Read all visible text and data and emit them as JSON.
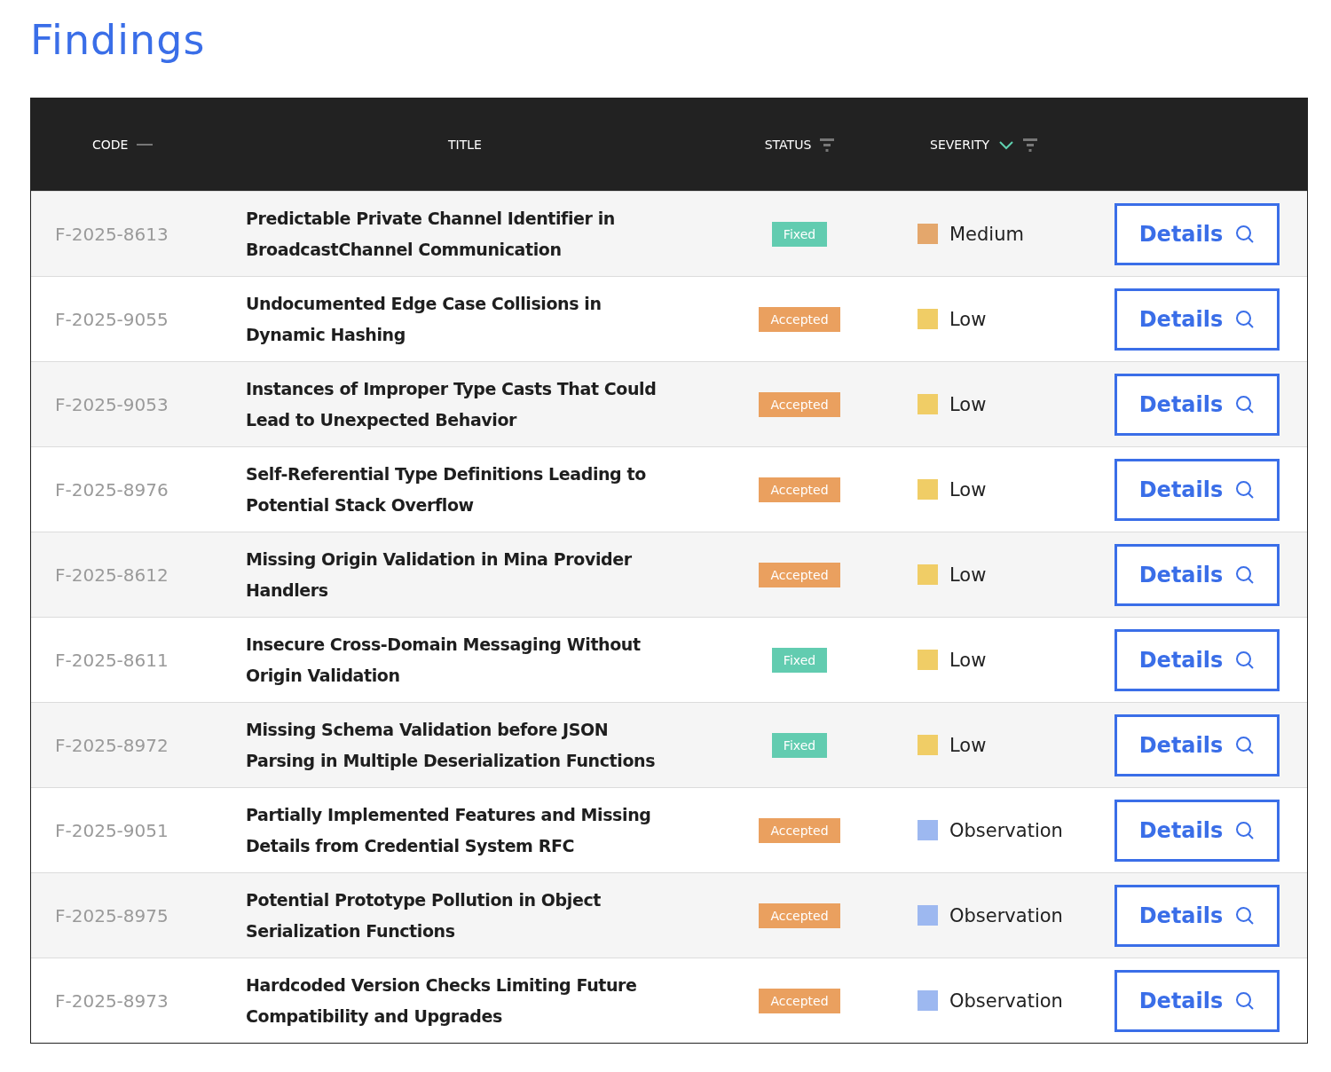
{
  "page_title": "Findings",
  "table": {
    "columns": [
      {
        "label": "CODE",
        "sortable": true,
        "sorted": false,
        "filter": false
      },
      {
        "label": "TITLE",
        "sortable": false,
        "filter": false
      },
      {
        "label": "STATUS",
        "sortable": false,
        "filter": true
      },
      {
        "label": "SEVERITY",
        "sortable": true,
        "sorted": true,
        "filter": true
      }
    ],
    "rows": [
      {
        "code": "F-2025-8613",
        "title": "Predictable Private Channel Identifier in BroadcastChannel Communication",
        "status": "Fixed",
        "severity": "Medium",
        "color": "#e4a76c",
        "action": "Details"
      },
      {
        "code": "F-2025-9055",
        "title": "Undocumented Edge Case Collisions in Dynamic Hashing",
        "status": "Accepted",
        "severity": "Low",
        "color": "#f0cd66",
        "action": "Details"
      },
      {
        "code": "F-2025-9053",
        "title": "Instances of Improper Type Casts That Could Lead to Unexpected Behavior",
        "status": "Accepted",
        "severity": "Low",
        "color": "#f0cd66",
        "action": "Details"
      },
      {
        "code": "F-2025-8976",
        "title": "Self-Referential Type Definitions Leading to Potential Stack Overflow",
        "status": "Accepted",
        "severity": "Low",
        "color": "#f0cd66",
        "action": "Details"
      },
      {
        "code": "F-2025-8612",
        "title": "Missing Origin Validation in Mina Provider Handlers",
        "status": "Accepted",
        "severity": "Low",
        "color": "#f0cd66",
        "action": "Details"
      },
      {
        "code": "F-2025-8611",
        "title": "Insecure Cross-Domain Messaging Without Origin Validation",
        "status": "Fixed",
        "severity": "Low",
        "color": "#f0cd66",
        "action": "Details"
      },
      {
        "code": "F-2025-8972",
        "title": "Missing Schema Validation before JSON Parsing in Multiple Deserialization Functions",
        "status": "Fixed",
        "severity": "Low",
        "color": "#f0cd66",
        "action": "Details"
      },
      {
        "code": "F-2025-9051",
        "title": "Partially Implemented Features and Missing Details from Credential System RFC",
        "status": "Accepted",
        "severity": "Observation",
        "color": "#9db8f0",
        "action": "Details"
      },
      {
        "code": "F-2025-8975",
        "title": "Potential Prototype Pollution in Object Serialization Functions",
        "status": "Accepted",
        "severity": "Observation",
        "color": "#9db8f0",
        "action": "Details"
      },
      {
        "code": "F-2025-8973",
        "title": "Hardcoded Version Checks Limiting Future Compatibility and Upgrades",
        "status": "Accepted",
        "severity": "Observation",
        "color": "#9db8f0",
        "action": "Details"
      }
    ]
  }
}
